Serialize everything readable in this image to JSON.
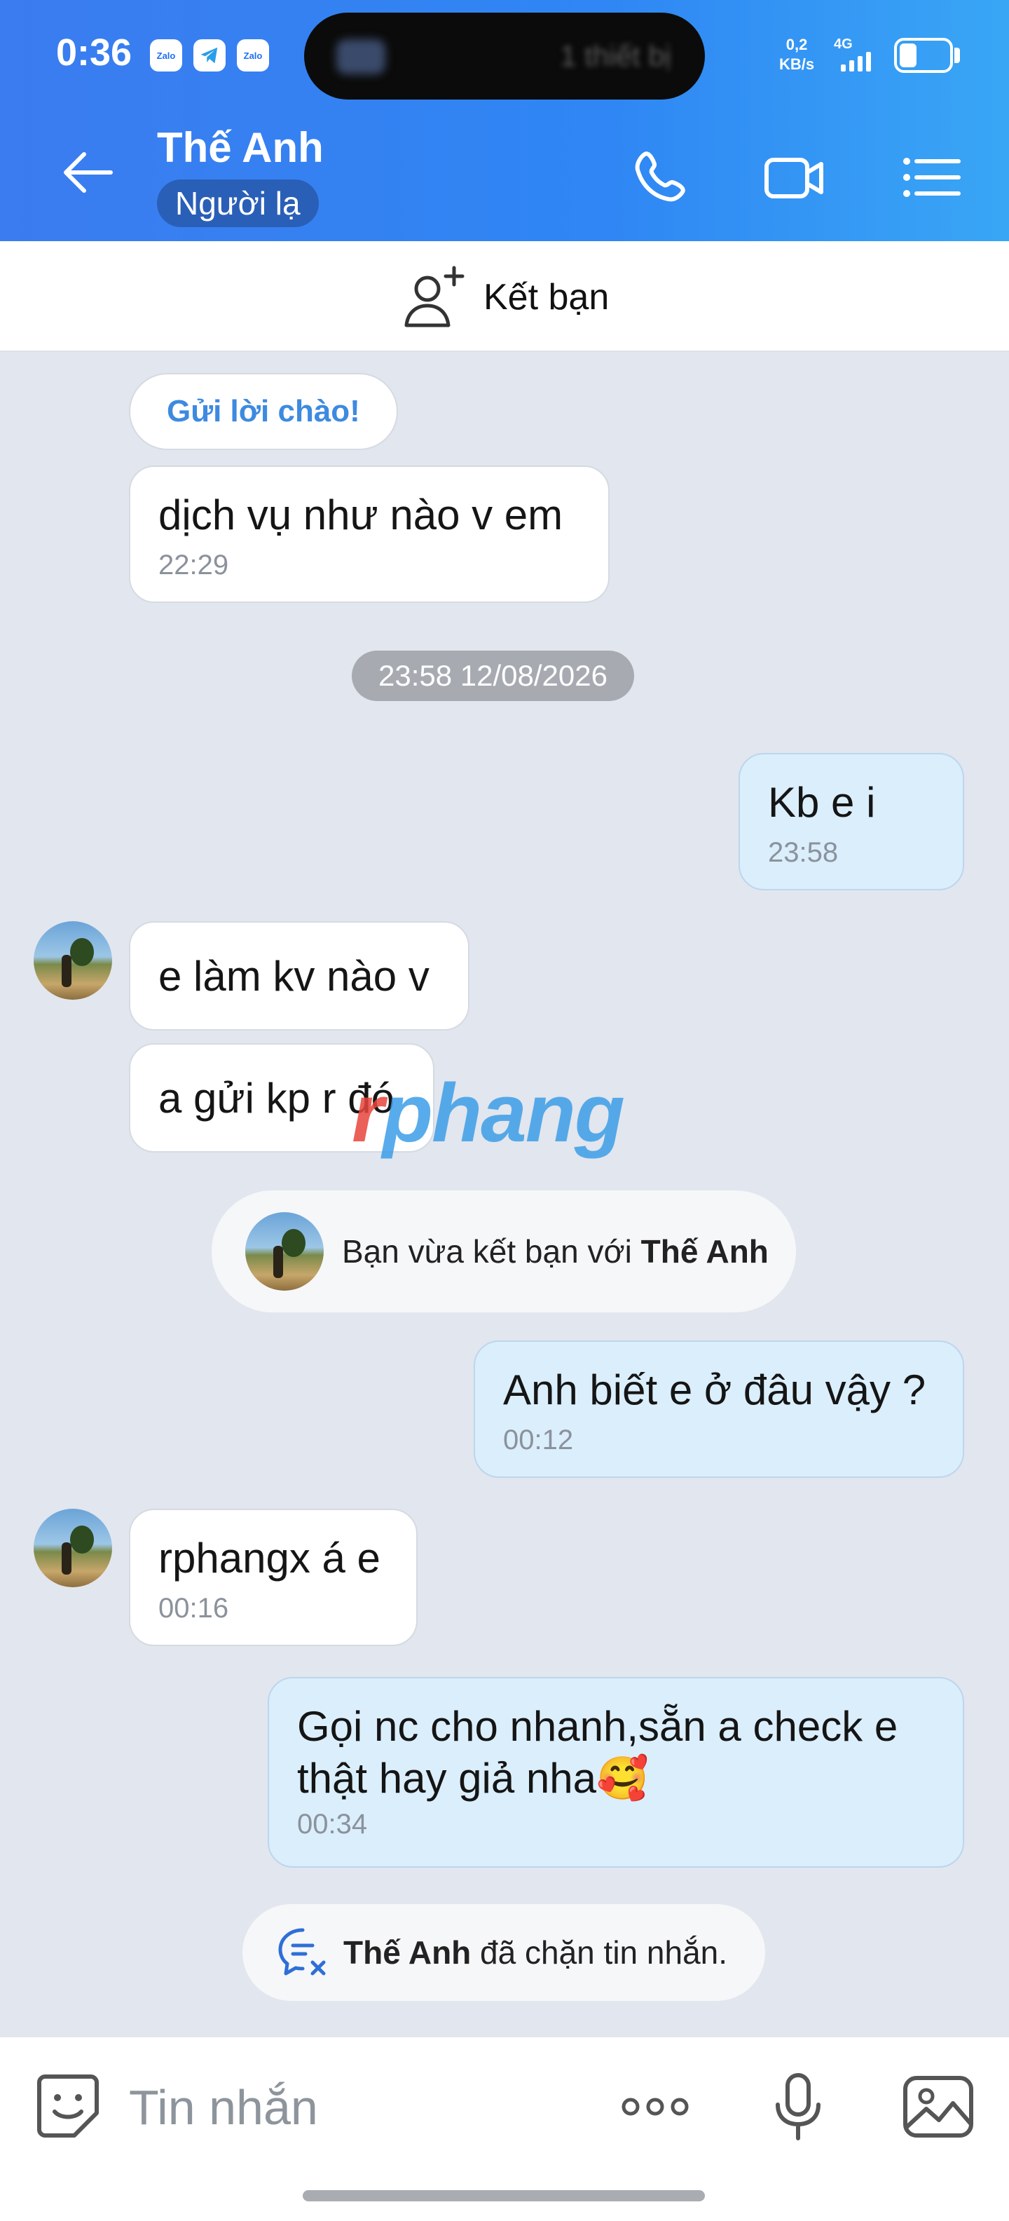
{
  "status_bar": {
    "time": "0:36",
    "app_badges": [
      "Zalo",
      "Telegram",
      "Zalo"
    ],
    "island_text": "1 thiết bị",
    "net_speed_value": "0,2",
    "net_speed_unit": "KB/s",
    "network": "4G"
  },
  "header": {
    "name": "Thế Anh",
    "tag": "Người lạ"
  },
  "add_friend": {
    "label": "Kết bạn"
  },
  "chat": {
    "greeting_chip": "Gửi lời chào!",
    "date_separator": "23:58 12/08/2026",
    "messages": [
      {
        "text": "dịch vụ như nào v em",
        "time": "22:29"
      },
      {
        "text": "Kb e i",
        "time": "23:58"
      },
      {
        "text": "e làm kv nào v"
      },
      {
        "text": "a gửi kp r đó"
      },
      {
        "text": "Anh biết e ở đâu vậy ?",
        "time": "00:12"
      },
      {
        "text": "rphangx á e",
        "time": "00:16"
      },
      {
        "text_line1": "Gọi nc cho nhanh,sẵn a check e",
        "text_line2": "thật hay giả nha🥰",
        "time": "00:34"
      }
    ],
    "friend_notice": {
      "prefix": "Bạn vừa kết bạn với ",
      "name": "Thế Anh"
    },
    "blocked_notice": {
      "name": "Thế Anh",
      "suffix": " đã chặn tin nhắn."
    }
  },
  "watermark": {
    "first": "r",
    "rest": "phang"
  },
  "input_bar": {
    "placeholder": "Tin nhắn"
  },
  "colors": {
    "header_blue": "#3b7cf0",
    "my_bubble": "#dbeefc",
    "chat_bg": "#e2e6ee"
  },
  "icons": [
    "back-arrow-icon",
    "phone-icon",
    "video-call-icon",
    "menu-list-icon",
    "add-friend-icon",
    "emoji-sticker-icon",
    "more-dots-icon",
    "microphone-icon",
    "image-gallery-icon",
    "blocked-chat-icon"
  ]
}
